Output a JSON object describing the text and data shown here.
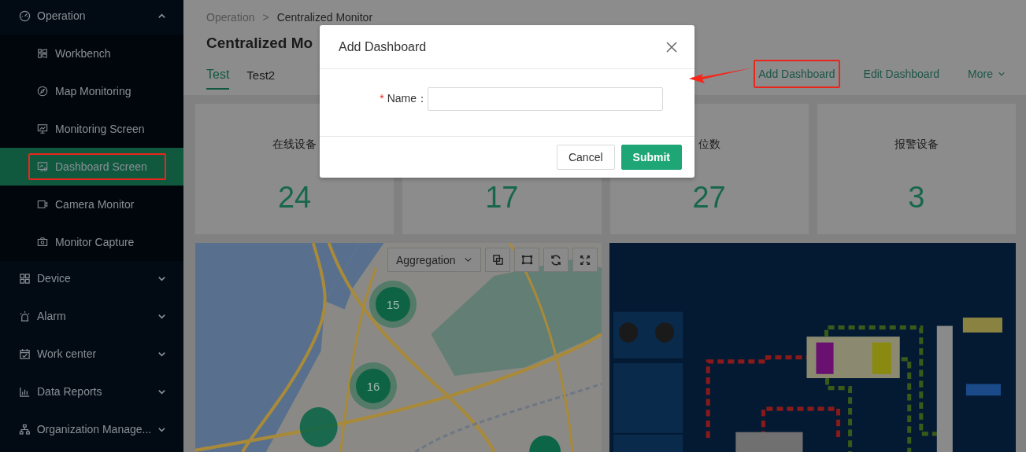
{
  "sidebar": {
    "items": [
      {
        "label": "Operation",
        "expanded": true,
        "children": [
          {
            "label": "Workbench",
            "selected": false,
            "highlighted": false
          },
          {
            "label": "Map Monitoring",
            "selected": false,
            "highlighted": false
          },
          {
            "label": "Monitoring Screen",
            "selected": false,
            "highlighted": false
          },
          {
            "label": "Dashboard Screen",
            "selected": true,
            "highlighted": true
          },
          {
            "label": "Camera Monitor",
            "selected": false,
            "highlighted": false
          },
          {
            "label": "Monitor Capture",
            "selected": false,
            "highlighted": false
          }
        ]
      },
      {
        "label": "Device",
        "expanded": false
      },
      {
        "label": "Alarm",
        "expanded": false
      },
      {
        "label": "Work center",
        "expanded": false
      },
      {
        "label": "Data Reports",
        "expanded": false
      },
      {
        "label": "Organization Manage...",
        "expanded": false
      }
    ]
  },
  "breadcrumb": {
    "items": [
      "Operation",
      "Centralized Monitor"
    ],
    "separator": ">"
  },
  "title": "Centralized Mo",
  "tabs": [
    {
      "label": "Test",
      "selected": true
    },
    {
      "label": "Test2",
      "selected": false
    }
  ],
  "actions": [
    {
      "label": "Add Dashboard",
      "highlighted": true,
      "pointer_arrow": true,
      "dropdown": false
    },
    {
      "label": "Edit Dashboard",
      "highlighted": false,
      "pointer_arrow": false,
      "dropdown": false
    },
    {
      "label": "More",
      "highlighted": false,
      "pointer_arrow": false,
      "dropdown": true
    }
  ],
  "stats": [
    {
      "label": "在线设备",
      "value": "24"
    },
    {
      "value": "17"
    },
    {
      "label": "位数",
      "value": "27"
    },
    {
      "label": "报警设备",
      "value": "3"
    }
  ],
  "map": {
    "kind": "picture",
    "aggregation": "Aggregation",
    "clusters": [
      {
        "count": "15"
      },
      {
        "count": "16"
      }
    ]
  },
  "dialog": {
    "title": "Add Dashboard",
    "fields": [
      {
        "required_mark": "*",
        "label": "Name："
      }
    ],
    "buttons": [
      {
        "label": "Cancel",
        "kind": "default"
      },
      {
        "label": "Submit",
        "kind": "primary"
      }
    ]
  }
}
